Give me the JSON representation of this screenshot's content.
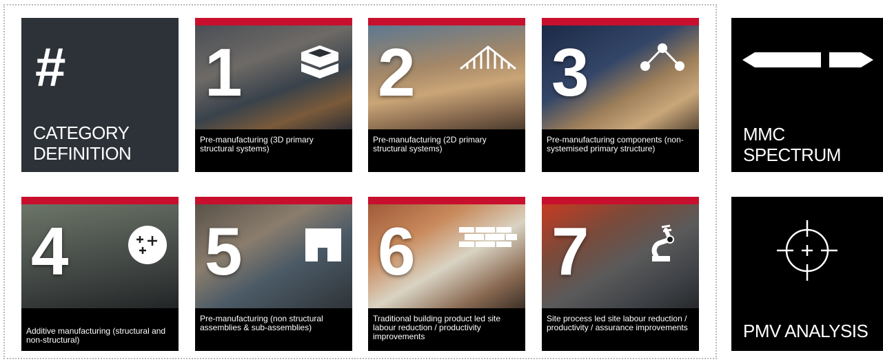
{
  "category_definition": {
    "symbol": "#",
    "label": "CATEGORY DEFINITION"
  },
  "categories": [
    {
      "number": "1",
      "description": "Pre-manufacturing (3D primary structural systems)",
      "icon": "stacked-box-icon"
    },
    {
      "number": "2",
      "description": "Pre-manufacturing (2D primary structural systems)",
      "icon": "roof-truss-icon"
    },
    {
      "number": "3",
      "description": "Pre-manufacturing components (non-systemised primary structure)",
      "icon": "node-connection-icon"
    },
    {
      "number": "4",
      "description": "Additive manufacturing (structural and non-structural)",
      "icon": "sparkle-circle-icon"
    },
    {
      "number": "5",
      "description": "Pre-manufacturing (non structural assemblies & sub-assemblies)",
      "icon": "panel-notch-icon"
    },
    {
      "number": "6",
      "description": "Traditional building product led site labour reduction / productivity improvements",
      "icon": "brick-wall-icon"
    },
    {
      "number": "7",
      "description": "Site process led site labour reduction / productivity / assurance improvements",
      "icon": "robot-arm-icon"
    }
  ],
  "mmc_spectrum": {
    "label": "MMC SPECTRUM",
    "icon": "double-arrow-icon"
  },
  "pmv_analysis": {
    "label": "PMV ANALYSIS",
    "icon": "crosshair-icon"
  },
  "colors": {
    "accent_red": "#c8102e",
    "definition_bg": "#2d3239",
    "tile_bg": "#000000",
    "text": "#ffffff"
  }
}
